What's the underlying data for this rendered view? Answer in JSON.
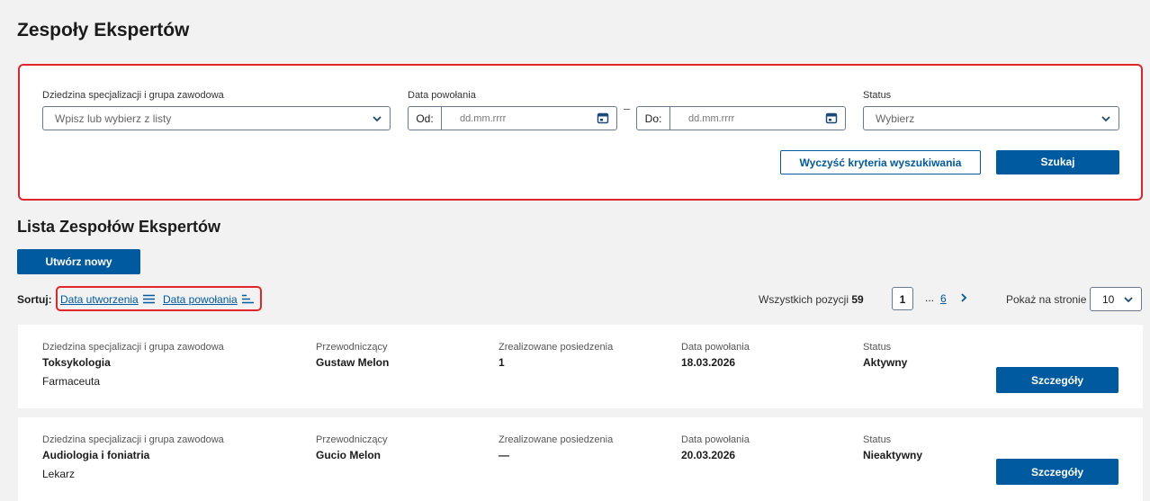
{
  "page": {
    "title": "Zespoły Ekspertów"
  },
  "search": {
    "specialization_label": "Dziedzina specjalizacji i grupa zawodowa",
    "specialization_placeholder": "Wpisz lub wybierz z listy",
    "date_label": "Data powołania",
    "from_label": "Od:",
    "to_label": "Do:",
    "date_placeholder": "dd.mm.rrrr",
    "dash": "–",
    "status_label": "Status",
    "status_placeholder": "Wybierz",
    "clear_button": "Wyczyść kryteria wyszukiwania",
    "search_button": "Szukaj"
  },
  "list": {
    "title": "Lista Zespołów Ekspertów",
    "create_button": "Utwórz nowy",
    "sort_label": "Sortuj:",
    "sort_options": [
      "Data utworzenia",
      "Data powołania"
    ],
    "total_label": "Wszystkich pozycji",
    "total_count": "59",
    "pagination": {
      "current": "1",
      "ellipsis": "...",
      "last": "6"
    },
    "per_page_label": "Pokaż na stronie",
    "per_page_value": "10"
  },
  "columns": {
    "specialization": "Dziedzina specjalizacji i grupa zawodowa",
    "chair": "Przewodniczący",
    "meetings": "Zrealizowane posiedzenia",
    "date": "Data powołania",
    "status": "Status"
  },
  "details_button": "Szczegóły",
  "rows": [
    {
      "specialization": "Toksykologia",
      "profession": "Farmaceuta",
      "chair": "Gustaw Melon",
      "meetings": "1",
      "date": "18.03.2026",
      "status": "Aktywny"
    },
    {
      "specialization": "Audiologia i foniatria",
      "profession": "Lekarz",
      "chair": "Gucio Melon",
      "meetings": "—",
      "date": "20.03.2026",
      "status": "Nieaktywny"
    }
  ],
  "colors": {
    "primary": "#005aa0",
    "highlight": "#e0252b",
    "background": "#f2f2f2"
  }
}
